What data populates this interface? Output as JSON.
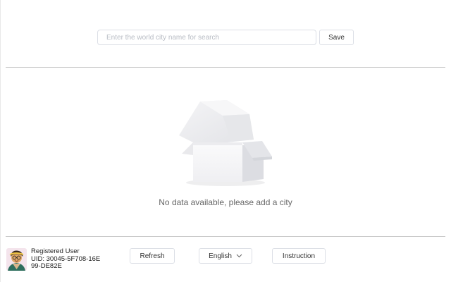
{
  "search": {
    "placeholder": "Enter the world city name for search",
    "value": "",
    "save_label": "Save"
  },
  "empty_state": {
    "message": "No data available, please add a city",
    "icon": "empty-box-icon"
  },
  "footer": {
    "user_title": "Registered User",
    "user_uid": "UID: 30045-5F708-16E99-DE82E",
    "refresh_label": "Refresh",
    "language_label": "English",
    "language_chevron": "chevron-down-icon",
    "instruction_label": "Instruction"
  }
}
